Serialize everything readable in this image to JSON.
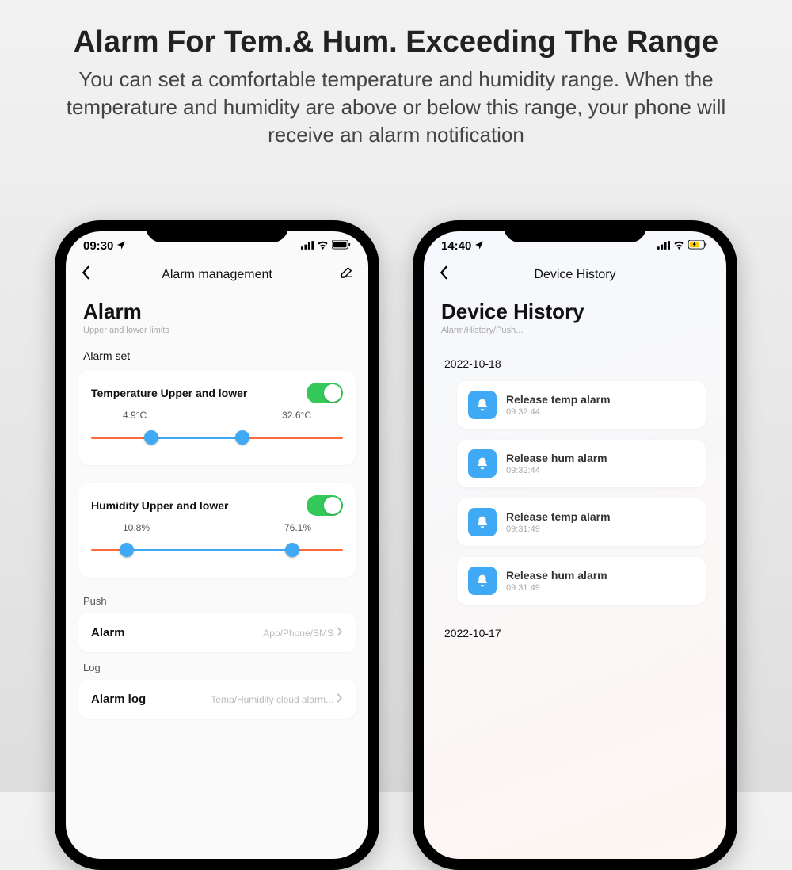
{
  "hero": {
    "title": "Alarm For Tem.& Hum. Exceeding The Range",
    "subtitle": "You can set a comfortable temperature and humidity range. When the temperature and humidity are above or below this range, your phone will receive an alarm notification"
  },
  "phone_left": {
    "status_time": "09:30",
    "nav_title": "Alarm management",
    "big_title": "Alarm",
    "subtitle": "Upper and lower limits",
    "alarm_set_label": "Alarm set",
    "temp": {
      "title": "Temperature Upper and lower",
      "low": "4.9°C",
      "high": "32.6°C",
      "low_pct": 24,
      "high_pct": 60
    },
    "hum": {
      "title": "Humidity Upper and lower",
      "low": "10.8%",
      "high": "76.1%",
      "low_pct": 14,
      "high_pct": 80
    },
    "push_label": "Push",
    "alarm_row_label": "Alarm",
    "alarm_row_hint": "App/Phone/SMS",
    "log_label": "Log",
    "alarm_log_label": "Alarm log",
    "alarm_log_hint": "Temp/Humidity cloud alarm..."
  },
  "phone_right": {
    "status_time": "14:40",
    "nav_title": "Device History",
    "big_title": "Device History",
    "subtitle": "Alarm/History/Push...",
    "groups": [
      {
        "date": "2022-10-18",
        "items": [
          {
            "title": "Release temp alarm",
            "time": "09:32:44"
          },
          {
            "title": "Release hum alarm",
            "time": "09:32:44"
          },
          {
            "title": "Release temp alarm",
            "time": "09:31:49"
          },
          {
            "title": "Release hum alarm",
            "time": "09:31:49"
          }
        ]
      },
      {
        "date": "2022-10-17",
        "items": []
      }
    ]
  }
}
